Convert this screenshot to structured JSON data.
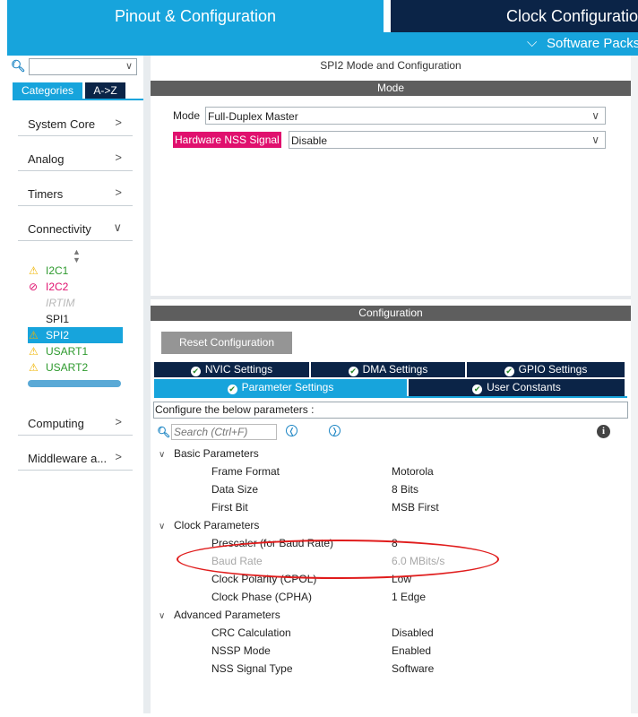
{
  "header": {
    "tab_pinout": "Pinout & Configuration",
    "tab_clock": "Clock Configuration",
    "software_packs": "Software Packs"
  },
  "sidebar": {
    "search_value": "",
    "tabs": {
      "categories": "Categories",
      "az": "A->Z"
    },
    "categories": [
      {
        "label": "System Core",
        "arrow": "right"
      },
      {
        "label": "Analog",
        "arrow": "right"
      },
      {
        "label": "Timers",
        "arrow": "right"
      },
      {
        "label": "Connectivity",
        "arrow": "down"
      },
      {
        "label": "Computing",
        "arrow": "right"
      },
      {
        "label": "Middleware a...",
        "arrow": "right"
      }
    ],
    "peripherals": [
      {
        "name": "I2C1",
        "status": "warning"
      },
      {
        "name": "I2C2",
        "status": "blocked"
      },
      {
        "name": "IRTIM",
        "status": "unavailable"
      },
      {
        "name": "SPI1",
        "status": "none"
      },
      {
        "name": "SPI2",
        "status": "warning",
        "selected": true
      },
      {
        "name": "USART1",
        "status": "warning"
      },
      {
        "name": "USART2",
        "status": "warning"
      }
    ]
  },
  "mode_panel": {
    "title": "SPI2 Mode and Configuration",
    "section": "Mode",
    "mode_label": "Mode",
    "mode_value": "Full-Duplex Master",
    "nss_label": "Hardware NSS Signal",
    "nss_value": "Disable"
  },
  "config_panel": {
    "section": "Configuration",
    "reset_button": "Reset Configuration",
    "tabs_row1": [
      "NVIC Settings",
      "DMA Settings",
      "GPIO Settings"
    ],
    "tabs_row2": [
      "Parameter Settings",
      "User Constants"
    ],
    "active_tab": "Parameter Settings",
    "description": "Configure the below parameters :",
    "search_placeholder": "Search (Ctrl+F)",
    "groups": [
      {
        "name": "Basic Parameters",
        "params": [
          {
            "name": "Frame Format",
            "value": "Motorola"
          },
          {
            "name": "Data Size",
            "value": "8 Bits"
          },
          {
            "name": "First Bit",
            "value": "MSB First"
          }
        ]
      },
      {
        "name": "Clock Parameters",
        "params": [
          {
            "name": "Prescaler (for Baud Rate)",
            "value": "8"
          },
          {
            "name": "Baud Rate",
            "value": "6.0 MBits/s",
            "disabled": true
          },
          {
            "name": "Clock Polarity (CPOL)",
            "value": "Low"
          },
          {
            "name": "Clock Phase (CPHA)",
            "value": "1 Edge"
          }
        ]
      },
      {
        "name": "Advanced Parameters",
        "params": [
          {
            "name": "CRC Calculation",
            "value": "Disabled"
          },
          {
            "name": "NSSP Mode",
            "value": "Enabled"
          },
          {
            "name": "NSS Signal Type",
            "value": "Software"
          }
        ]
      }
    ]
  },
  "colors": {
    "accent": "#17a4dc",
    "navy": "#0b2447",
    "warning": "#f0b400",
    "error": "#e0106e",
    "highlight": "#e01c1c"
  }
}
